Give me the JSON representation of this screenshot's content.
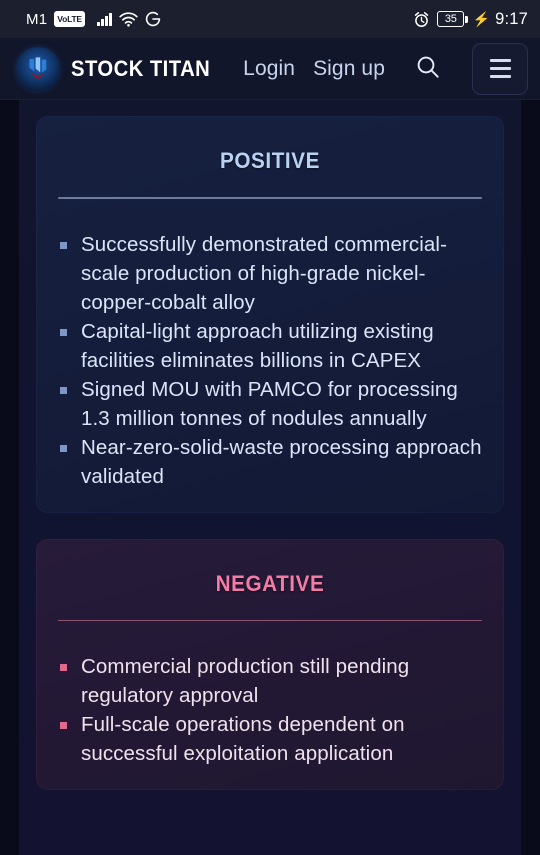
{
  "status_bar": {
    "carrier": "M1",
    "volte_label": "VoLTE",
    "network_icon": "signal-bars-icon",
    "wifi_icon": "wifi-icon",
    "app_icon": "google-g-icon",
    "alarm_icon": "alarm-clock-icon",
    "battery_level": "35",
    "charging_icon": "charging-bolt-icon",
    "time": "9:17"
  },
  "navbar": {
    "logo_icon": "stock-titan-logo-icon",
    "brand": "STOCK TITAN",
    "login_label": "Login",
    "signup_label": "Sign up",
    "search_icon": "search-icon",
    "menu_icon": "hamburger-menu-icon"
  },
  "cards": {
    "positive": {
      "title": "Positive",
      "accent": "#b9d2f2",
      "bullets": [
        "Successfully demonstrated commercial-scale production of high-grade nickel-copper-cobalt alloy",
        "Capital-light approach utilizing existing facilities eliminates billions in CAPEX",
        "Signed MOU with PAMCO for processing 1.3 million tonnes of nodules annually",
        "Near-zero-solid-waste processing approach validated"
      ]
    },
    "negative": {
      "title": "Negative",
      "accent": "#f37ba6",
      "bullets": [
        "Commercial production still pending regulatory approval",
        "Full-scale operations dependent on successful exploitation application"
      ]
    }
  }
}
